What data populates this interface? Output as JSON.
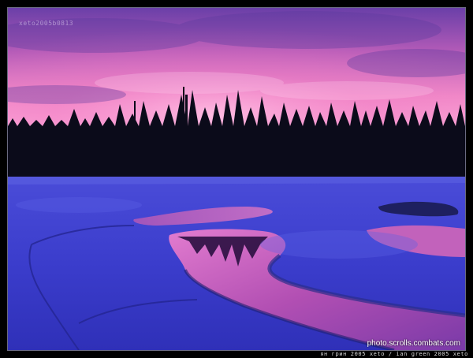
{
  "image": {
    "subject": "winter-river-sunset",
    "colors": {
      "sky_top": "#7a4fb2",
      "sky_glow": "#f08ac8",
      "sky_horizon": "#ff9fd8",
      "tree_line": "#0b0b1a",
      "snow": "#3d3fd1",
      "snow_shadow": "#2a2c9c",
      "water": "#c35bb8",
      "frame": "#000000"
    }
  },
  "watermarks": {
    "top_left": "xeto2005b0813",
    "bottom_right_site": "photo.scrolls.combats.com",
    "bottom_strip": "ян грин 2005 xeto / ian green 2005 xeto"
  }
}
